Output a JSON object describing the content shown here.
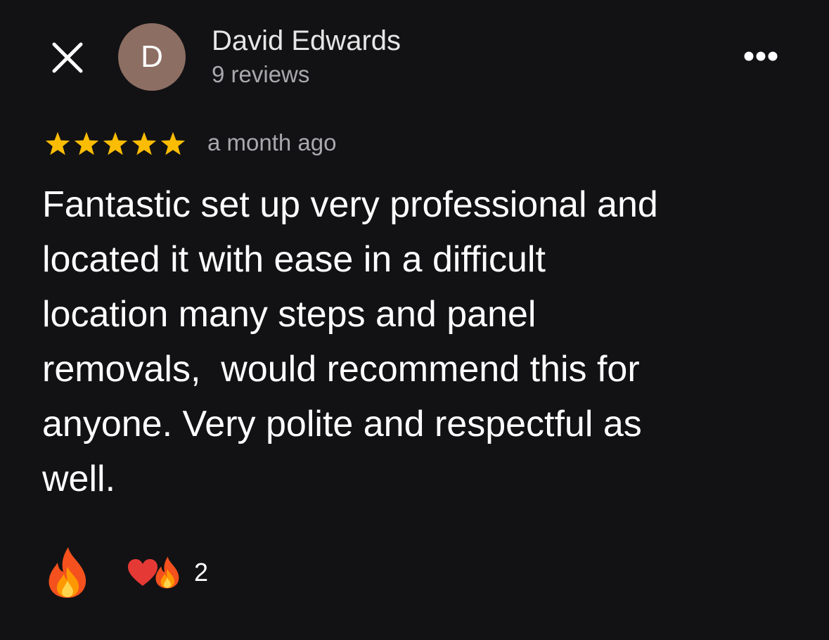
{
  "header": {
    "close_icon": "close-icon",
    "avatar_initial": "D",
    "avatar_color": "#8d6e63",
    "reviewer_name": "David Edwards",
    "review_count": "9 reviews",
    "more_icon": "more-horizontal-icon"
  },
  "review": {
    "rating": 5,
    "max_rating": 5,
    "star_color": "#fbbc04",
    "date": "a month ago",
    "text": "Fantastic set up very professional and\nlocated it with ease in a difficult\nlocation many steps and panel\nremovals,  would recommend this for\nanyone. Very polite and respectful as\nwell."
  },
  "reactions": {
    "add_reaction_icon": "fire-icon",
    "summary_icons": [
      "heart-icon",
      "fire-icon"
    ],
    "count": "2"
  },
  "colors": {
    "background": "#121214",
    "primary_text": "#ffffff",
    "secondary_text": "#a9a9ad"
  }
}
